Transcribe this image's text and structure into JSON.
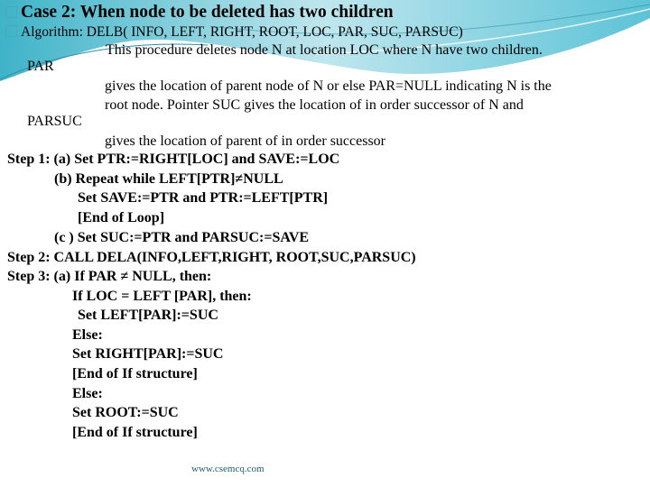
{
  "slide": {
    "title": "Case 2: When node to be deleted has two children",
    "algorithm_label": "Algorithm:",
    "algorithm_signature": "DELB( INFO, LEFT, RIGHT, ROOT, LOC, PAR, SUC, PARSUC)",
    "description": [
      "This procedure deletes node N at location LOC where N have two children.",
      "PAR",
      "gives the location of parent node of N or else PAR=NULL indicating N is the",
      "root node. Pointer SUC gives the location of in order successor of N and",
      "PARSUC",
      "gives the location of parent of in order successor"
    ],
    "steps": [
      "Step 1: (a) Set PTR:=RIGHT[LOC] and SAVE:=LOC",
      "(b) Repeat while LEFT[PTR]≠NULL",
      "Set SAVE:=PTR and PTR:=LEFT[PTR]",
      "[End of Loop]",
      "(c ) Set SUC:=PTR and PARSUC:=SAVE",
      "Step 2: CALL DELA(INFO,LEFT,RIGHT, ROOT,SUC,PARSUC)",
      "Step 3: (a) If PAR ≠ NULL, then:",
      "If LOC = LEFT [PAR], then:",
      "Set LEFT[PAR]:=SUC",
      "Else:",
      "Set RIGHT[PAR]:=SUC",
      "[End of If structure]",
      "Else:",
      "Set ROOT:=SUC",
      "[End of If structure]"
    ],
    "footer": "www.csemcq.com",
    "bullet_icon": "square-bullet",
    "theme_colors": {
      "accent": "#4aa8b8",
      "swoosh_light": "#bfe6ee",
      "swoosh_dark": "#39a3bd",
      "footer": "#1b5e6b"
    }
  }
}
